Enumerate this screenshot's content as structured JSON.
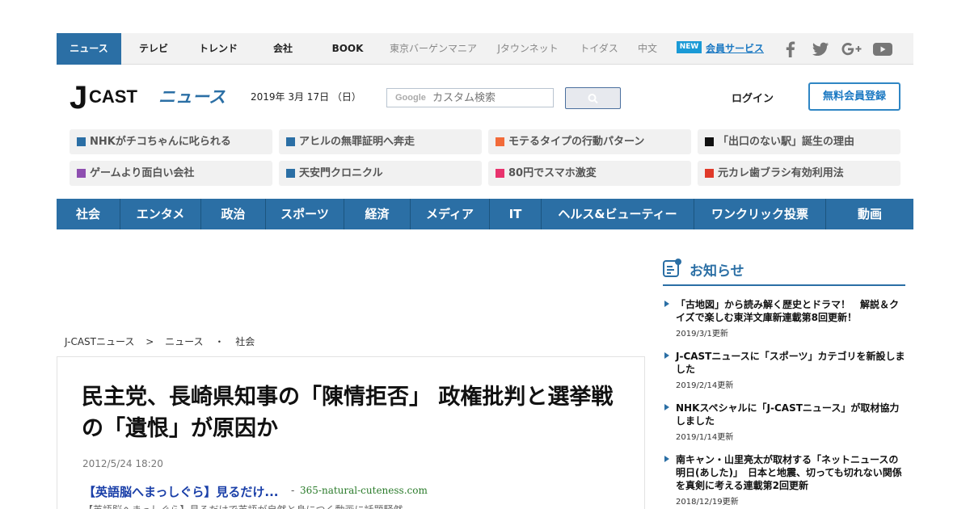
{
  "topbar": {
    "tabs": [
      {
        "label": "ニュース"
      },
      {
        "label": "テレビ"
      },
      {
        "label": "トレンド"
      },
      {
        "label": "会社"
      },
      {
        "label": "BOOK"
      }
    ],
    "sub_links": [
      {
        "label": "東京バーゲンマニア"
      },
      {
        "label": "Jタウンネット"
      },
      {
        "label": "トイダス"
      },
      {
        "label": "中文"
      }
    ],
    "new_badge": "NEW",
    "member_link": "会員サービス",
    "social_icons": [
      "facebook-icon",
      "twitter-icon",
      "google-plus-icon",
      "youtube-icon"
    ]
  },
  "header": {
    "logo_j": "J",
    "logo_cast": "CAST",
    "logo_news": "ニュース",
    "date": "2019年 3月 17日 （日）",
    "search_brand": "Google",
    "search_placeholder": "カスタム検索",
    "login": "ログイン",
    "signup": "無料会員登録"
  },
  "trending": [
    {
      "label": "NHKがチコちゃんに叱られる",
      "color": "#2b6fa5"
    },
    {
      "label": "アヒルの無罪証明へ奔走",
      "color": "#2b6fa5"
    },
    {
      "label": "モテるタイプの行動パターン",
      "color": "#f26b3a"
    },
    {
      "label": "「出口のない駅」誕生の理由",
      "color": "#111111"
    },
    {
      "label": "ゲームより面白い会社",
      "color": "#8e4fb0"
    },
    {
      "label": "天安門クロニクル",
      "color": "#2b6fa5"
    },
    {
      "label": "80円でスマホ激変",
      "color": "#e8336d"
    },
    {
      "label": "元カレ歯ブラシ有効利用法",
      "color": "#e03a2a"
    }
  ],
  "categories": [
    {
      "label": "社会"
    },
    {
      "label": "エンタメ"
    },
    {
      "label": "政治"
    },
    {
      "label": "スポーツ"
    },
    {
      "label": "経済"
    },
    {
      "label": "メディア"
    },
    {
      "label": "IT"
    },
    {
      "label": "ヘルス&ビューティー"
    },
    {
      "label": "ワンクリック投票"
    },
    {
      "label": "動画"
    }
  ],
  "breadcrumb": [
    "J-CASTニュース",
    ">",
    "ニュース",
    "・",
    "社会"
  ],
  "article": {
    "title": "民主党、長崎県知事の「陳情拒否」 政権批判と選挙戦の「遺恨」が原因か",
    "date": "2012/5/24 18:20",
    "ad_title": "【英語脳へまっしぐら】見るだけ...",
    "ad_sep": "-",
    "ad_url": "365-natural-cuteness.com",
    "ad_desc": "【英語脳へまっしぐら】見るだけで英語が自然と身につく動画に話題騒然"
  },
  "notices": {
    "title": "お知らせ",
    "items": [
      {
        "text": "「古地図」から読み解く歴史とドラマ！　解説＆クイズで楽しむ東洋文庫新連載第8回更新！",
        "date": "2019/3/1更新"
      },
      {
        "text": "J-CASTニュースに「スポーツ」カテゴリを新設しました",
        "date": "2019/2/14更新"
      },
      {
        "text": "NHKスペシャルに「J-CASTニュース」が取材協力しました",
        "date": "2019/1/14更新"
      },
      {
        "text": "南キャン・山里亮太が取材する「ネットニュースの明日(あした)」　日本と地震、切っても切れない関係を真剣に考える連載第2回更新",
        "date": "2018/12/19更新"
      }
    ]
  },
  "colors": {
    "brand_blue": "#2b6fa5",
    "link_blue": "#1a78c2"
  }
}
